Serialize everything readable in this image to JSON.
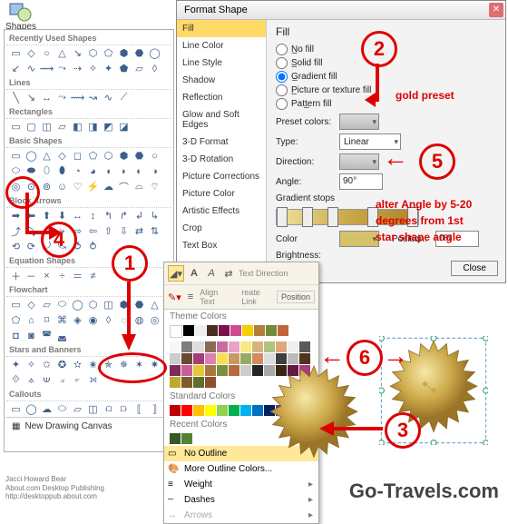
{
  "shapesBtn": {
    "label": "Shapes"
  },
  "gallery": {
    "sections": [
      {
        "title": "Recently Used Shapes",
        "rows": 3
      },
      {
        "title": "Lines",
        "rows": 1
      },
      {
        "title": "Rectangles",
        "rows": 1
      },
      {
        "title": "Basic Shapes",
        "rows": 4
      },
      {
        "title": "Block Arrows",
        "rows": 3
      },
      {
        "title": "Equation Shapes",
        "rows": 1
      },
      {
        "title": "Flowchart",
        "rows": 3
      },
      {
        "title": "Stars and Banners",
        "rows": 2
      },
      {
        "title": "Callouts",
        "rows": 2
      }
    ],
    "footer": "New Drawing Canvas"
  },
  "fmtShape": {
    "title": "Format Shape",
    "nav": [
      "Fill",
      "Line Color",
      "Line Style",
      "Shadow",
      "Reflection",
      "Glow and Soft Edges",
      "3-D Format",
      "3-D Rotation",
      "Picture Corrections",
      "Picture Color",
      "Artistic Effects",
      "Crop",
      "Text Box"
    ],
    "heading": "Fill",
    "radios": [
      {
        "label": "No fill",
        "checked": false
      },
      {
        "label": "Solid fill",
        "checked": false
      },
      {
        "label": "Gradient fill",
        "checked": true
      },
      {
        "label": "Picture or texture fill",
        "checked": false
      },
      {
        "label": "Pattern fill",
        "checked": false
      }
    ],
    "preset": "Preset colors:",
    "type": "Type:",
    "typeVal": "Linear",
    "direction": "Direction:",
    "angle": "Angle:",
    "angleVal": "90°",
    "gradStops": "Gradient stops",
    "color": "Color",
    "brightness": "Brightness:",
    "position": "Position:",
    "positionVal": "0%",
    "close": "Close"
  },
  "outlineMenu": {
    "toolbar": {
      "textDir": "Text Direction",
      "alignText": "Align Text",
      "position": "Position",
      "createLink": "reate Link"
    },
    "themeColors": "Theme Colors",
    "standardColors": "Standard Colors",
    "recentColors": "Recent Colors",
    "noOutline": "No Outline",
    "moreColors": "More Outline Colors...",
    "weight": "Weight",
    "dashes": "Dashes",
    "arrows": "Arrows"
  },
  "annotations": {
    "goldPreset": "gold preset",
    "angleNote1": "alter Angle by 5-20",
    "angleNote2": "degrees from 1st",
    "angleNote3": "star shape angle",
    "n1": "1",
    "n2": "2",
    "n3": "3",
    "n4": "4",
    "n5": "5",
    "n6": "6"
  },
  "credit": {
    "l1": "Jacci Howard Bear",
    "l2": "About.com Desktop Publishing",
    "l3": "http://desktoppub.about.com"
  },
  "watermark": "Go-Travels.com"
}
